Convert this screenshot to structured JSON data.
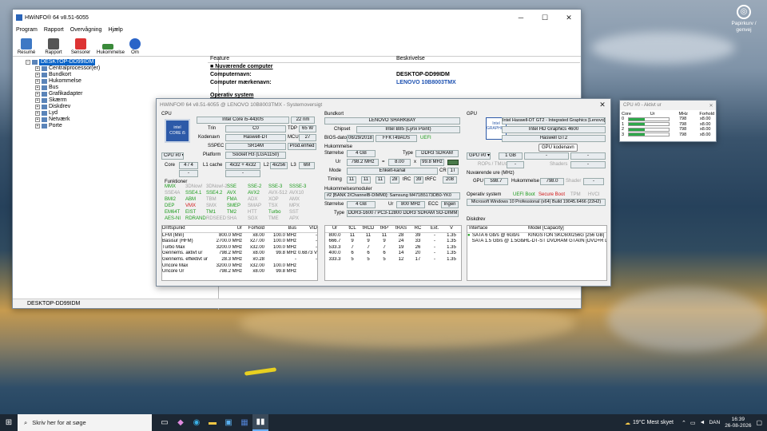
{
  "desktop": {
    "recycle_label": "Papirkurv / genvej"
  },
  "main_window": {
    "title": "HWiNFO® 64 v8.51-6055",
    "menu": [
      "Program",
      "Rapport",
      "Overvågning",
      "Hjælp"
    ],
    "toolbar": [
      "Resumé",
      "Rapport",
      "Sensorer",
      "Hukommelse",
      "Om"
    ],
    "tree": {
      "root": "DESKTOP-DD99IDM",
      "items": [
        "Centralprocessor(er)",
        "Bundkort",
        "Hukommelse",
        "Bus",
        "Grafikadapter",
        "Skærm",
        "Diskdrev",
        "Lyd",
        "Netværk",
        "Porte"
      ]
    },
    "detail": {
      "col_feature": "Feature",
      "col_desc": "Beskrivelse",
      "h1": "Nuværende computer",
      "r1k": "Computernavn:",
      "r1v": "DESKTOP-DD99IDM",
      "r2k": "Computer mærkenavn:",
      "r2v": "LENOVO 10B8003TMX",
      "h2": "Operativ system"
    },
    "status": "DESKTOP-DD99IDM"
  },
  "summary": {
    "title": "HWiNFO® 64 v8.51-6055 @ LENOVO 10B8003TMX - Systemoversigt",
    "cpu": {
      "section": "CPU",
      "name": "Intel Core i5-4430S",
      "nm": "22 nm",
      "trin_l": "Trin",
      "trin": "C0",
      "tdp_l": "TDP",
      "tdp": "65 W",
      "kode_l": "Kodenavn",
      "kode": "Haswell-DT",
      "mcu_l": "MCU",
      "mcu": "27",
      "sspec_l": "SSPEC",
      "sspec": "SR14M",
      "prod": "Prod.enhed",
      "plat_l": "Platform",
      "plat": "Socket H3 (LGA1150)",
      "sel": "CPU #0",
      "core_l": "Core",
      "core": "4 / 4",
      "l1_l": "L1 cache",
      "l1": "4x32 + 4x32",
      "l2_l": "L2",
      "l2": "4x256",
      "l3_l": "L3",
      "l3": "6M",
      "func": "Funktioner",
      "features": [
        [
          "MMX",
          "3DNow!",
          "3DNow!-2",
          "SSE",
          "SSE-2",
          "SSE-3",
          "SSSE-3"
        ],
        [
          "SSE4A",
          "SSE4.1",
          "SSE4.2",
          "AVX",
          "AVX2",
          "AVX-512",
          "AVX10"
        ],
        [
          "BMI2",
          "ABM",
          "TBM",
          "FMA",
          "ADX",
          "XOP",
          "AMX"
        ],
        [
          "DEP",
          "VMX",
          "SMX",
          "SMEP",
          "SMAP",
          "TSX",
          "MPX"
        ],
        [
          "EM64T",
          "EIST",
          "TM1",
          "TM2",
          "HTT",
          "Turbo",
          "SST"
        ],
        [
          "AES-NI",
          "RDRAND",
          "RDSEED",
          "SHA",
          "SGX",
          "TME",
          "APX"
        ]
      ],
      "table_head": [
        "Driftspunkt",
        "Ur",
        "Forhold",
        "Bus",
        "VID"
      ],
      "table": [
        [
          "LFM (Min)",
          "800.0 MHz",
          "x8.00",
          "100.0 MHz",
          "-"
        ],
        [
          "Basisur (HFM)",
          "2700.0 MHz",
          "x27.00",
          "100.0 MHz",
          "-"
        ],
        [
          "Turbo Max",
          "3200.0 MHz",
          "x32.00",
          "100.0 MHz",
          "-"
        ],
        [
          "Gennems. aktivt ur",
          "798.2 MHz",
          "x8.00",
          "99.8 MHz",
          "0.6873 V"
        ],
        [
          "Gennems. effektivt ur",
          "28.3 MHz",
          "x0.28",
          "-",
          "-"
        ],
        [
          "Uncore Max",
          "3200.0 MHz",
          "x32.00",
          "100.0 MHz",
          ""
        ],
        [
          "Uncore Ur",
          "798.2 MHz",
          "x8.00",
          "99.8 MHz",
          ""
        ]
      ]
    },
    "mb": {
      "section": "Bundkort",
      "name": "LENOVO SHARKBAY",
      "chip_l": "Chipset",
      "chip": "Intel B85 (Lynx Point)",
      "bios_l": "BIOS-dato",
      "bios": "06/29/2018",
      "biosver": "FFKT49AUS",
      "uefi": "UEFI",
      "mem_sec": "Hukommelse",
      "size_l": "Størrelse",
      "size": "4 GB",
      "type_l": "Type",
      "type": "DDR3 SDRAM",
      "ur_l": "Ur",
      "ur": "798.2 MHz",
      "eq": "=",
      "mult": "8.00",
      "x": "x",
      "bus": "99.8 MHz",
      "mode_l": "Mode",
      "mode": "Enkelt-kanal",
      "cr_l": "CR",
      "cr": "1T",
      "timing_l": "Timing",
      "t1": "11",
      "t2": "11",
      "t3": "11",
      "t4": "28",
      "trc_l": "tRC",
      "trc": "39",
      "trfc_l": "tRFC",
      "trfc": "208",
      "mod_sec": "Hukommelsesmoduler",
      "mod": "#2 [BANK 2/ChannelB-DIMM0]: Samsung M471B5173DB0-YK0",
      "msize_l": "Størrelse",
      "msize": "4 GB",
      "mur_l": "Ur",
      "mur": "800 MHz",
      "ecc_l": "ECC",
      "ecc": "Ingen",
      "mtype_l": "Type",
      "mtype": "DDR3-1600 / PC3-12800 DDR3 SDRAM SO-DIMM",
      "timings_head": [
        "Ur",
        "tCL",
        "tRCD",
        "tRP",
        "tRAS",
        "RC",
        "Ext.",
        "V"
      ],
      "timings": [
        [
          "800.0",
          "11",
          "11",
          "11",
          "28",
          "39",
          "-",
          "1.35"
        ],
        [
          "666.7",
          "9",
          "9",
          "9",
          "24",
          "33",
          "-",
          "1.35"
        ],
        [
          "533.3",
          "7",
          "7",
          "7",
          "19",
          "26",
          "-",
          "1.35"
        ],
        [
          "400.0",
          "6",
          "6",
          "6",
          "14",
          "20",
          "-",
          "1.35"
        ],
        [
          "333.3",
          "5",
          "5",
          "5",
          "12",
          "17",
          "-",
          "1.35"
        ]
      ]
    },
    "gpu": {
      "section": "GPU",
      "name": "Intel Haswell-DT GT2 - Integrated Graphics [Lenovo]",
      "model": "Intel HD Graphics 4600",
      "code": "Haswell GT2",
      "tooltip": "GPU kodenavn",
      "sel": "GPU #0",
      "mem": "1 GB",
      "rops": "ROPs / TMUs",
      "shaders": "Shaders",
      "clocks": "Nuværende ure (MHz)",
      "gpu_l": "GPU",
      "gpu": "598.7",
      "mem_l": "Hukommelse",
      "memclk": "798.0",
      "shader_l": "Shader",
      "os_l": "Operativ system",
      "uefi_boot": "UEFI Boot",
      "secure": "Secure Boot",
      "tpm": "TPM",
      "hvci": "HVCI",
      "os": "Microsoft Windows 10 Professional (x64) Build 19045.6466 (22H2)",
      "drives": "Diskdrev",
      "dhead": [
        "Interface",
        "Model [Capacity]"
      ],
      "drives_list": [
        [
          "SATA 6 Gb/s @ 6Gb/s",
          "KINGSTON SKC600256G [256 GB]"
        ],
        [
          "SATA 1.5 Gb/s @ 1.5Gb/s",
          "HL-DT-ST DVDRAM GTA0N [DVD+R DL]"
        ]
      ]
    }
  },
  "cpu_mini": {
    "title": "CPU #0 - Aktivt ur",
    "head": [
      "Core",
      "Ur",
      "MHz",
      "Forhold"
    ],
    "rows": [
      [
        "0",
        "798",
        "x8.00"
      ],
      [
        "1",
        "798",
        "x8.00"
      ],
      [
        "2",
        "798",
        "x8.00"
      ],
      [
        "3",
        "798",
        "x8.00"
      ]
    ]
  },
  "taskbar": {
    "search": "Skriv her for at søge",
    "temp": "19°C  Mest skyet",
    "lang": "DAN",
    "time": "16:39",
    "date": "26-08-2026"
  },
  "colors": {
    "selection": "#0a64c8",
    "feature_green": "#1a9a1a",
    "feature_red": "#d01818",
    "feature_gray": "#a0a0a0"
  }
}
